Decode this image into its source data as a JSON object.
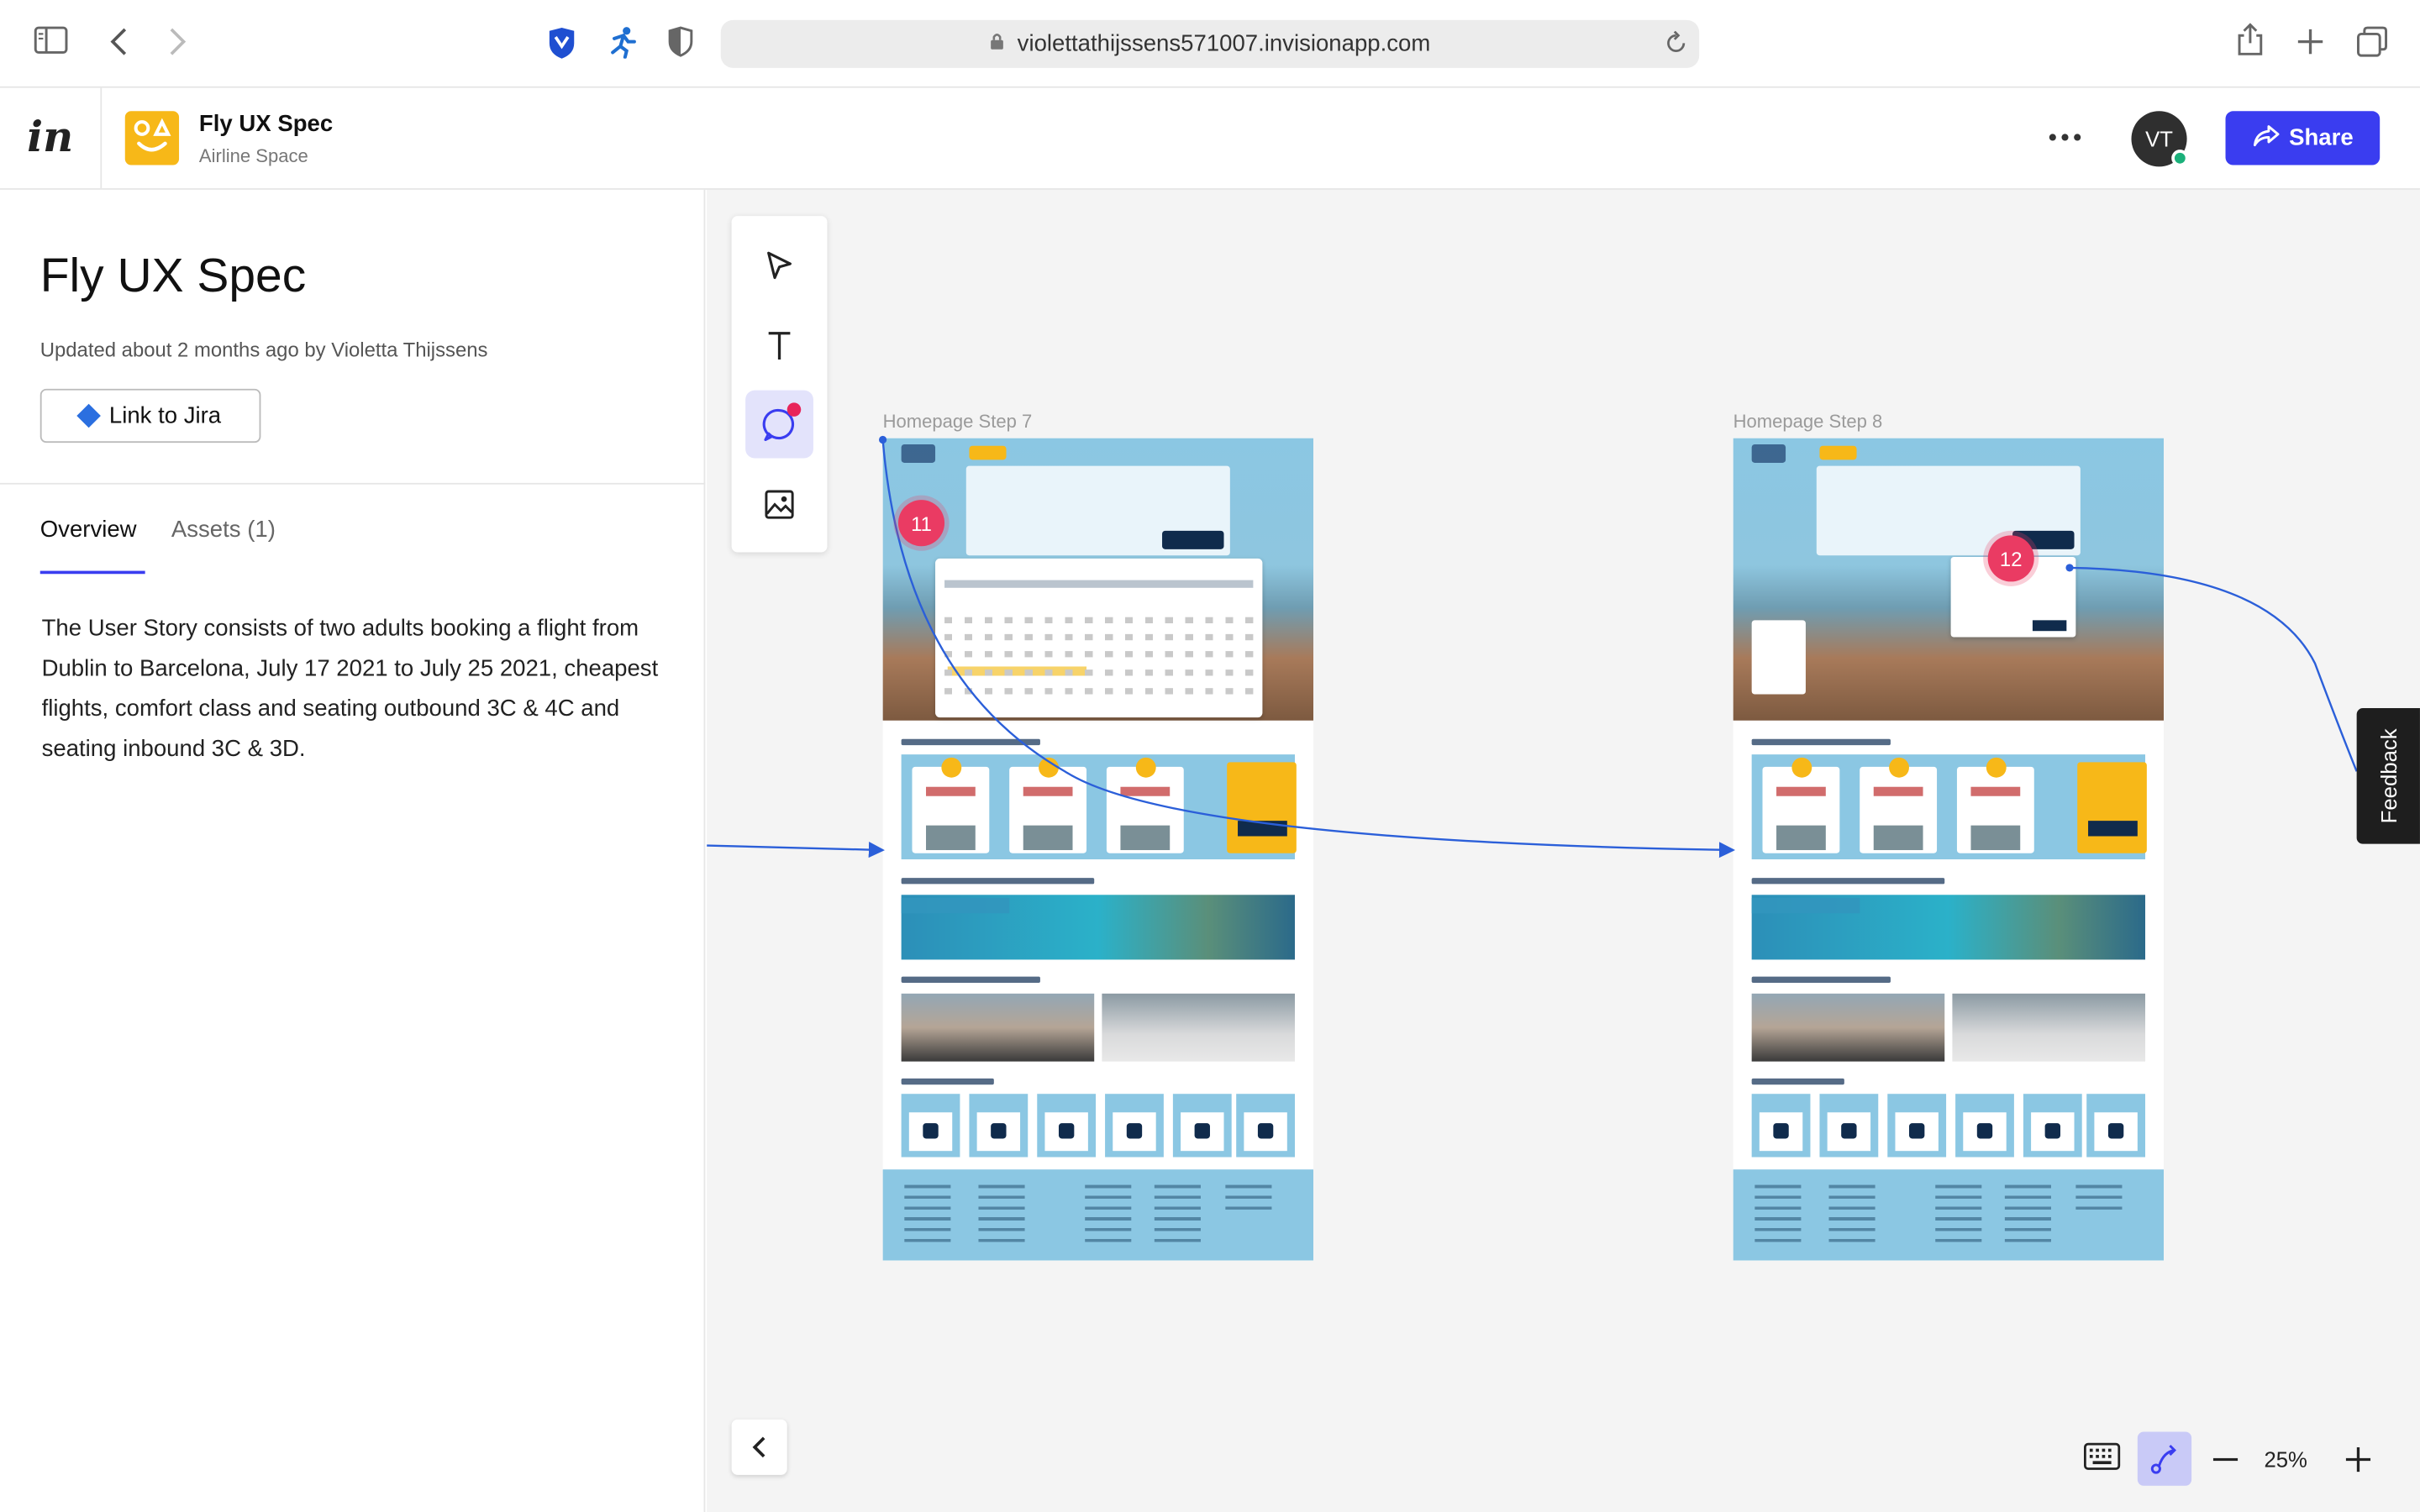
{
  "browser": {
    "url": "violettathijssens571007.invisionapp.com"
  },
  "header": {
    "logo_text": "in",
    "project_title": "Fly UX Spec",
    "project_subtitle": "Airline Space",
    "more_label": "•••",
    "avatar_initials": "VT",
    "share_label": "Share"
  },
  "panel": {
    "title": "Fly UX Spec",
    "updated": "Updated about 2 months ago by Violetta Thijssens",
    "jira_label": "Link to Jira",
    "tabs": [
      {
        "label": "Overview",
        "active": true
      },
      {
        "label": "Assets (1)",
        "active": false
      }
    ],
    "description": "The User Story consists of two adults booking a flight from Dublin to Barcelona, July 17 2021 to July 25 2021, cheapest flights, comfort class and seating outbound 3C & 4C and seating inbound 3C & 3D."
  },
  "canvas": {
    "artboards": [
      {
        "label": "Homepage Step 7",
        "hotspot": "11"
      },
      {
        "label": "Homepage Step 8",
        "hotspot": "12"
      }
    ],
    "feedback_label": "Feedback",
    "zoom": "25%"
  },
  "colors": {
    "accent": "#3a3df0",
    "hotspot": "#ea3b63",
    "brand_yellow": "#f7b818",
    "sky_blue": "#8bc7e3",
    "connector": "#2b5fd9"
  }
}
